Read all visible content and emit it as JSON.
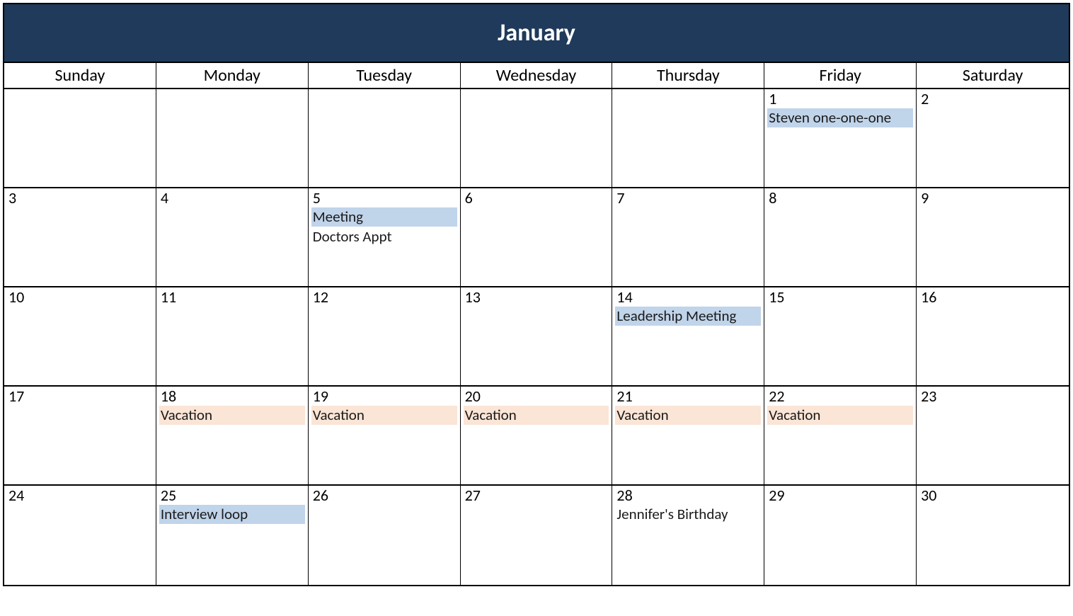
{
  "month": "January",
  "dayHeaders": [
    "Sunday",
    "Monday",
    "Tuesday",
    "Wednesday",
    "Thursday",
    "Friday",
    "Saturday"
  ],
  "eventColors": {
    "blue": "#c0d4ea",
    "orange": "#fbe5d6"
  },
  "weeks": [
    [
      {
        "num": "",
        "events": []
      },
      {
        "num": "",
        "events": []
      },
      {
        "num": "",
        "events": []
      },
      {
        "num": "",
        "events": []
      },
      {
        "num": "",
        "events": []
      },
      {
        "num": "1",
        "events": [
          {
            "label": "Steven one-one-one",
            "color": "blue"
          }
        ]
      },
      {
        "num": "2",
        "events": []
      }
    ],
    [
      {
        "num": "3",
        "events": []
      },
      {
        "num": "4",
        "events": []
      },
      {
        "num": "5",
        "events": [
          {
            "label": "Meeting",
            "color": "blue"
          },
          {
            "label": "Doctors Appt",
            "color": "plain"
          }
        ]
      },
      {
        "num": "6",
        "events": []
      },
      {
        "num": "7",
        "events": []
      },
      {
        "num": "8",
        "events": []
      },
      {
        "num": "9",
        "events": []
      }
    ],
    [
      {
        "num": "10",
        "events": []
      },
      {
        "num": "11",
        "events": []
      },
      {
        "num": "12",
        "events": []
      },
      {
        "num": "13",
        "events": []
      },
      {
        "num": "14",
        "events": [
          {
            "label": "Leadership Meeting",
            "color": "blue"
          }
        ]
      },
      {
        "num": "15",
        "events": []
      },
      {
        "num": "16",
        "events": []
      }
    ],
    [
      {
        "num": "17",
        "events": []
      },
      {
        "num": "18",
        "events": [
          {
            "label": "Vacation",
            "color": "orange"
          }
        ]
      },
      {
        "num": "19",
        "events": [
          {
            "label": "Vacation",
            "color": "orange"
          }
        ]
      },
      {
        "num": "20",
        "events": [
          {
            "label": "Vacation",
            "color": "orange"
          }
        ]
      },
      {
        "num": "21",
        "events": [
          {
            "label": "Vacation",
            "color": "orange"
          }
        ]
      },
      {
        "num": "22",
        "events": [
          {
            "label": "Vacation",
            "color": "orange"
          }
        ]
      },
      {
        "num": "23",
        "events": []
      }
    ],
    [
      {
        "num": "24",
        "events": []
      },
      {
        "num": "25",
        "events": [
          {
            "label": "Interview loop",
            "color": "blue"
          }
        ]
      },
      {
        "num": "26",
        "events": []
      },
      {
        "num": "27",
        "events": []
      },
      {
        "num": "28",
        "events": [
          {
            "label": "Jennifer's Birthday",
            "color": "plain"
          }
        ]
      },
      {
        "num": "29",
        "events": []
      },
      {
        "num": "30",
        "events": []
      }
    ]
  ]
}
